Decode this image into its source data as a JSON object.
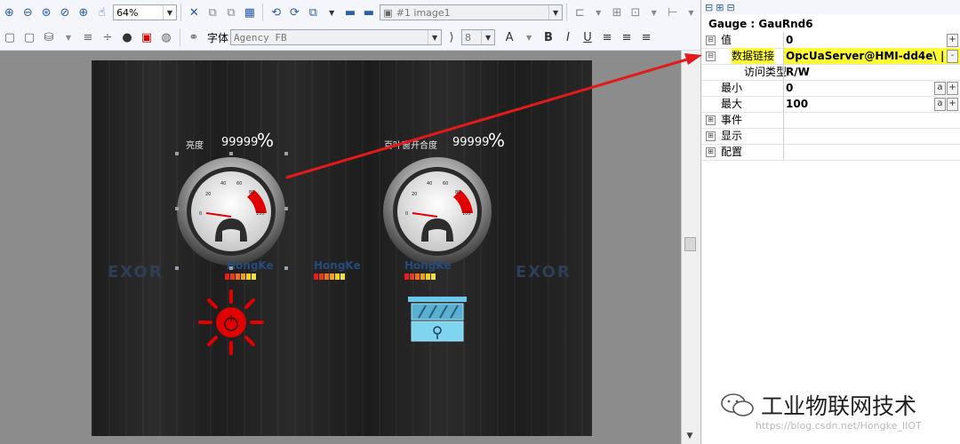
{
  "toolbar1": {
    "zoom_value": "64%",
    "image_combo_value": "#1 image1"
  },
  "toolbar2": {
    "font_label": "字体",
    "font_value": "Agency FB",
    "size_value": "8",
    "bold_label": "B",
    "italic_label": "I",
    "underline_label": "U"
  },
  "screen": {
    "gauge1_label": "亮度",
    "gauge1_value": "99999",
    "gauge1_unit": "%",
    "gauge2_label": "百叶窗开合度",
    "gauge2_value": "99999",
    "gauge2_unit": "%",
    "brand1": "HongKe",
    "brand2": "HongKe",
    "brand3": "HongKe",
    "logo_left": "EXOR",
    "logo_right": "EXOR",
    "scale_ticks": [
      "0",
      "20",
      "40",
      "60",
      "80",
      "100"
    ],
    "gauge1_level": 0,
    "gauge2_level": 0,
    "accent": "#e00000"
  },
  "panel": {
    "header": "Gauge : GauRnd6",
    "rows": [
      {
        "name": "值",
        "value": "0",
        "toggle": "⊟",
        "btn": "+"
      },
      {
        "name": "数据链接",
        "value": "OpcUaServer@HMI-dd4e\\ |",
        "toggle": "⊟",
        "btn": "-"
      },
      {
        "name": "访问类型",
        "value": "R/W",
        "toggle": "",
        "btn": ""
      },
      {
        "name": "最小",
        "value": "0",
        "toggle": "",
        "btn": "+"
      },
      {
        "name": "最大",
        "value": "100",
        "toggle": "",
        "btn": "+"
      },
      {
        "name": "事件",
        "value": "",
        "toggle": "⊞",
        "btn": ""
      },
      {
        "name": "显示",
        "value": "",
        "toggle": "⊞",
        "btn": ""
      },
      {
        "name": "配置",
        "value": "",
        "toggle": "⊞",
        "btn": ""
      }
    ]
  },
  "watermark": {
    "title": "工业物联网技术",
    "url": "https://blog.csdn.net/Hongke_IIOT"
  }
}
